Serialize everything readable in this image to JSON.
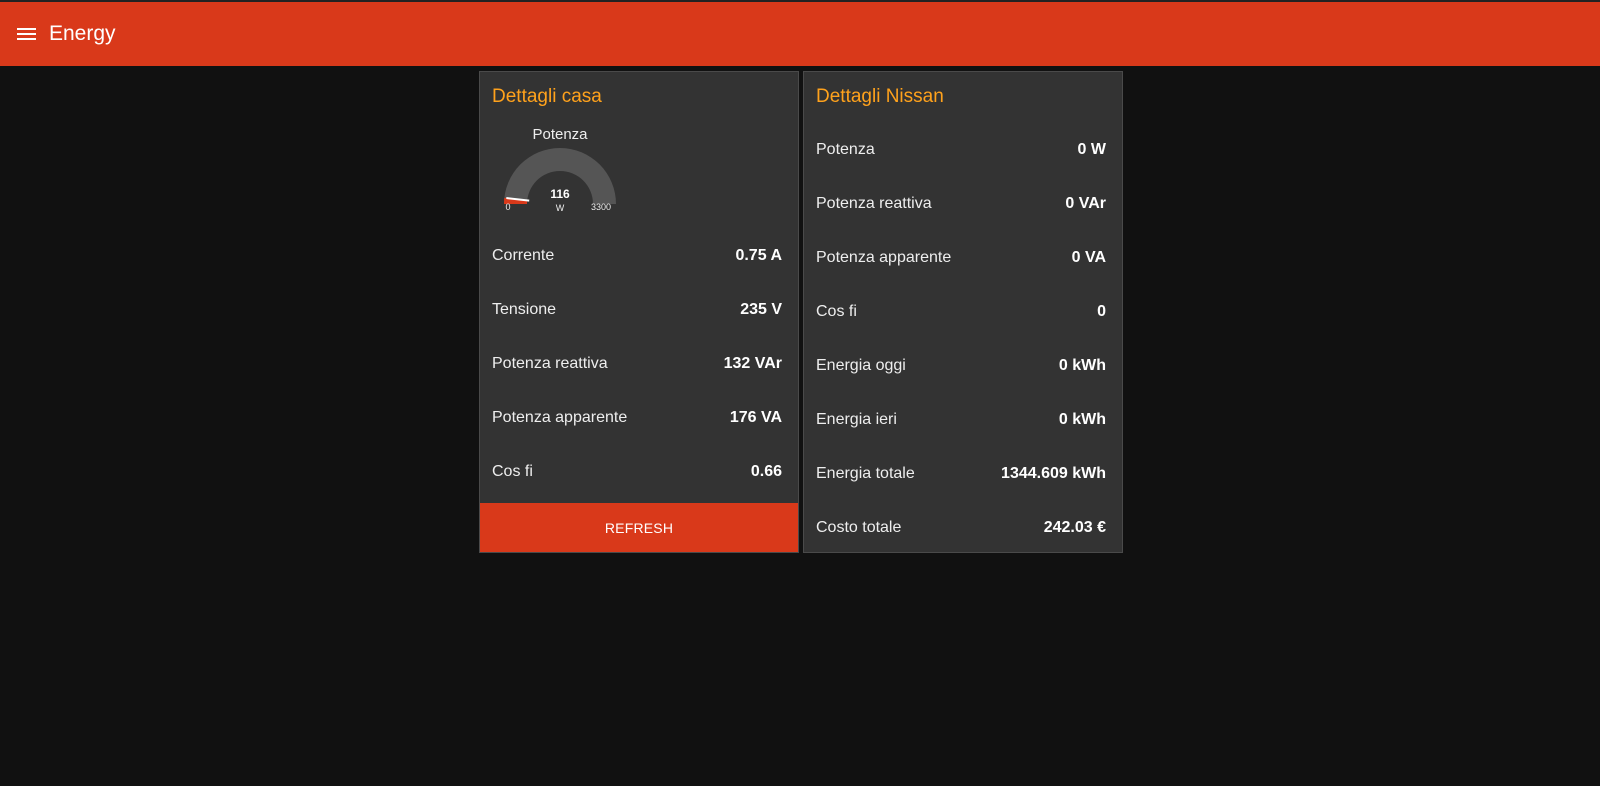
{
  "header": {
    "title": "Energy",
    "menu_icon": "hamburger-menu-icon",
    "background": "#d9391a"
  },
  "casa": {
    "title": "Dettagli casa",
    "gauge": {
      "title": "Potenza",
      "value": "116",
      "unit": "W",
      "min": "0",
      "max": "3300",
      "value_num": 116,
      "min_num": 0,
      "max_num": 3300,
      "track_color": "#555555",
      "fill_color": "#d9391a"
    },
    "rows": [
      {
        "label": "Corrente",
        "value": "0.75 A"
      },
      {
        "label": "Tensione",
        "value": "235 V"
      },
      {
        "label": "Potenza reattiva",
        "value": "132 VAr"
      },
      {
        "label": "Potenza apparente",
        "value": "176 VA"
      },
      {
        "label": "Cos fi",
        "value": "0.66"
      }
    ],
    "refresh_label": "REFRESH"
  },
  "nissan": {
    "title": "Dettagli Nissan",
    "rows": [
      {
        "label": "Potenza",
        "value": "0 W"
      },
      {
        "label": "Potenza reattiva",
        "value": "0 VAr"
      },
      {
        "label": "Potenza apparente",
        "value": "0 VA"
      },
      {
        "label": "Cos fi",
        "value": "0"
      },
      {
        "label": "Energia oggi",
        "value": "0 kWh"
      },
      {
        "label": "Energia ieri",
        "value": "0 kWh"
      },
      {
        "label": "Energia totale",
        "value": "1344.609 kWh"
      },
      {
        "label": "Costo totale",
        "value": "242.03 €"
      }
    ]
  },
  "colors": {
    "accent": "#ffa21c",
    "card_bg": "#333333",
    "page_bg": "#111111"
  }
}
